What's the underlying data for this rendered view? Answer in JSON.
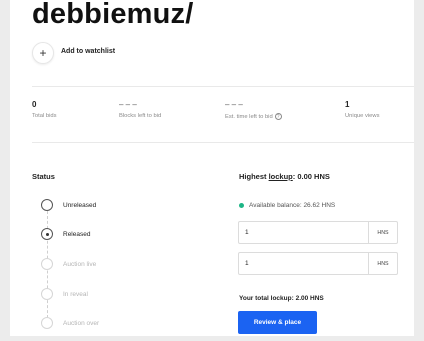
{
  "header": {
    "name": "debbiemuz/",
    "watch_icon": "+",
    "watch_label": "Add to watchlist"
  },
  "stats": [
    {
      "value": "0",
      "label": "Total bids"
    },
    {
      "value": "– – –",
      "label": "Blocks left to bid"
    },
    {
      "value": "– – –",
      "label": "Est. time left to bid"
    },
    {
      "value": "1",
      "label": "Unique views"
    }
  ],
  "help_icon_char": "?",
  "status": {
    "title": "Status",
    "steps": [
      {
        "label": "Unreleased",
        "state": "done"
      },
      {
        "label": "Released",
        "state": "current"
      },
      {
        "label": "Auction live",
        "state": "pending"
      },
      {
        "label": "In reveal",
        "state": "pending"
      },
      {
        "label": "Auction over",
        "state": "pending"
      }
    ]
  },
  "bid": {
    "heading_prefix": "Highest ",
    "heading_link": "lockup",
    "heading_suffix": ": 0.00 HNS",
    "balance": "Available balance: 26.62 HNS",
    "balance_color": "#1db586",
    "bid_value": "1",
    "bid_unit": "HNS",
    "lockup_value": "1",
    "lockup_unit": "HNS",
    "total_lockup": "Your total lockup: 2.00 HNS",
    "submit_label": "Review & place",
    "accent": "#1b63f2"
  }
}
